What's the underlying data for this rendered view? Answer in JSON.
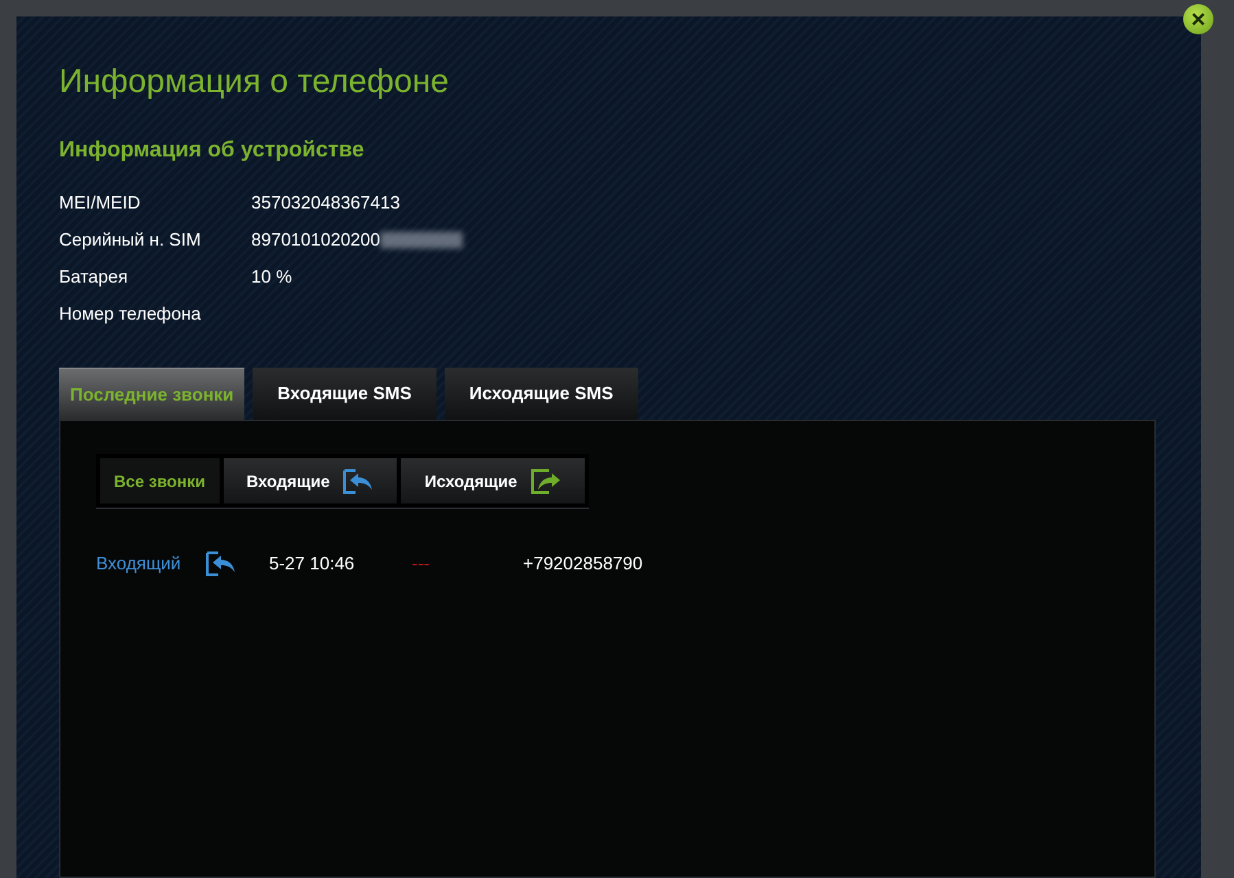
{
  "dialog": {
    "title": "Информация о телефоне",
    "close_icon": "×"
  },
  "device": {
    "heading": "Информация об устройстве",
    "rows": [
      {
        "label": "MEI/MEID",
        "value": "357032048367413",
        "redacted": false
      },
      {
        "label": "Серийный н. SIM",
        "value": "8970101020200",
        "redacted": true
      },
      {
        "label": "Батарея",
        "value": "10 %",
        "redacted": false
      },
      {
        "label": "Номер телефона",
        "redacted": false
      }
    ]
  },
  "tabs": [
    {
      "label": "Последние звонки",
      "selected": true
    },
    {
      "label": "Входящие SMS",
      "selected": false
    },
    {
      "label": "Исходящие SMS",
      "selected": false
    }
  ],
  "filters": [
    {
      "label": "Все звонки",
      "kind": "all",
      "selected": true
    },
    {
      "label": "Входящие",
      "kind": "incoming",
      "selected": false
    },
    {
      "label": "Исходящие",
      "kind": "outgoing",
      "selected": false
    }
  ],
  "calls": [
    {
      "type": "Входящий",
      "kind": "incoming",
      "time": "5-27 10:46",
      "duration": "---",
      "number": "+79202858790"
    }
  ]
}
